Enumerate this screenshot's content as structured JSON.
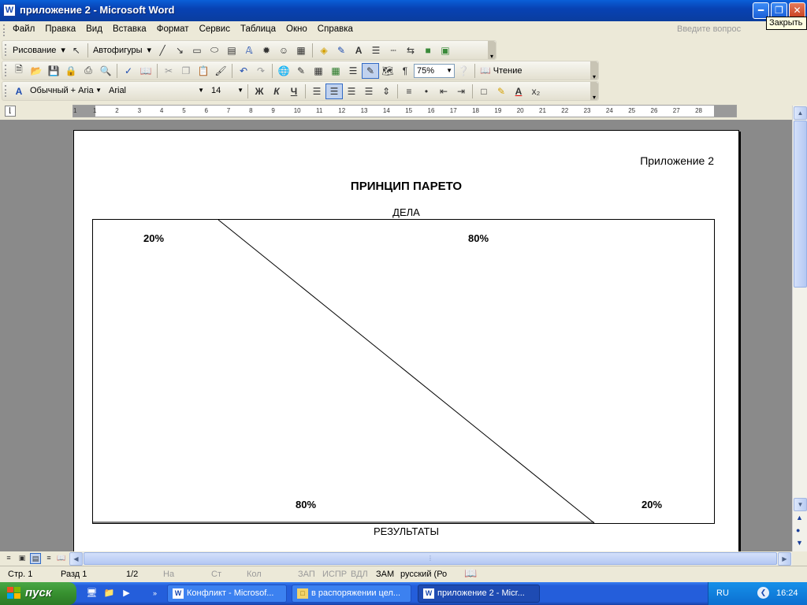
{
  "window": {
    "title": "приложение 2 - Microsoft Word",
    "app_icon": "W",
    "tooltip": "Закрыть",
    "controls": {
      "minimize": "minimize-icon",
      "restore": "restore-icon",
      "close": "close-icon"
    }
  },
  "menu": {
    "items": [
      "Файл",
      "Правка",
      "Вид",
      "Вставка",
      "Формат",
      "Сервис",
      "Таблица",
      "Окно",
      "Справка"
    ],
    "help_placeholder": "Введите вопрос"
  },
  "drawing_toolbar": {
    "draw_label": "Рисование",
    "autoshapes_label": "Автофигуры"
  },
  "standard_toolbar": {
    "zoom": "75%",
    "reading_label": "Чтение"
  },
  "formatting_toolbar": {
    "style": "Обычный + Aria",
    "font": "Arial",
    "size": "14",
    "bold": "Ж",
    "italic": "К",
    "underline": "Ч"
  },
  "ruler": {
    "numbers": [
      "1",
      "1",
      "2",
      "3",
      "4",
      "5",
      "6",
      "7",
      "8",
      "9",
      "10",
      "11",
      "12",
      "13",
      "14",
      "15",
      "16",
      "17",
      "18",
      "19",
      "20",
      "21",
      "22",
      "23",
      "24",
      "25",
      "26",
      "27",
      "28"
    ]
  },
  "document": {
    "appendix_label": "Приложение 2",
    "title": "ПРИНЦИП ПАРЕТО",
    "top_label": "ДЕЛА",
    "bottom_label": "РЕЗУЛЬТАТЫ",
    "top_left_pct": "20%",
    "top_right_pct": "80%",
    "bottom_left_pct": "80%",
    "bottom_right_pct": "20%"
  },
  "status": {
    "page": "Стр. 1",
    "section": "Разд 1",
    "pages": "1/2",
    "at": "На",
    "line": "Ст",
    "col": "Кол",
    "rec": "ЗАП",
    "trk": "ИСПР",
    "ext": "ВДЛ",
    "ovr": "ЗАМ",
    "language": "русский (Ро"
  },
  "taskbar": {
    "start_label": "пуск",
    "tasks": [
      {
        "label": "Конфликт - Microsof...",
        "active": false
      },
      {
        "label": "в распоряжении цел...",
        "active": false
      },
      {
        "label": "приложение 2 - Micr...",
        "active": true
      }
    ],
    "language": "RU",
    "clock": "16:24"
  },
  "colors": {
    "titlebar": "#0a5fd8",
    "taskbar": "#245edb",
    "start": "#37902f",
    "document_bg": "#8a8a8a"
  }
}
